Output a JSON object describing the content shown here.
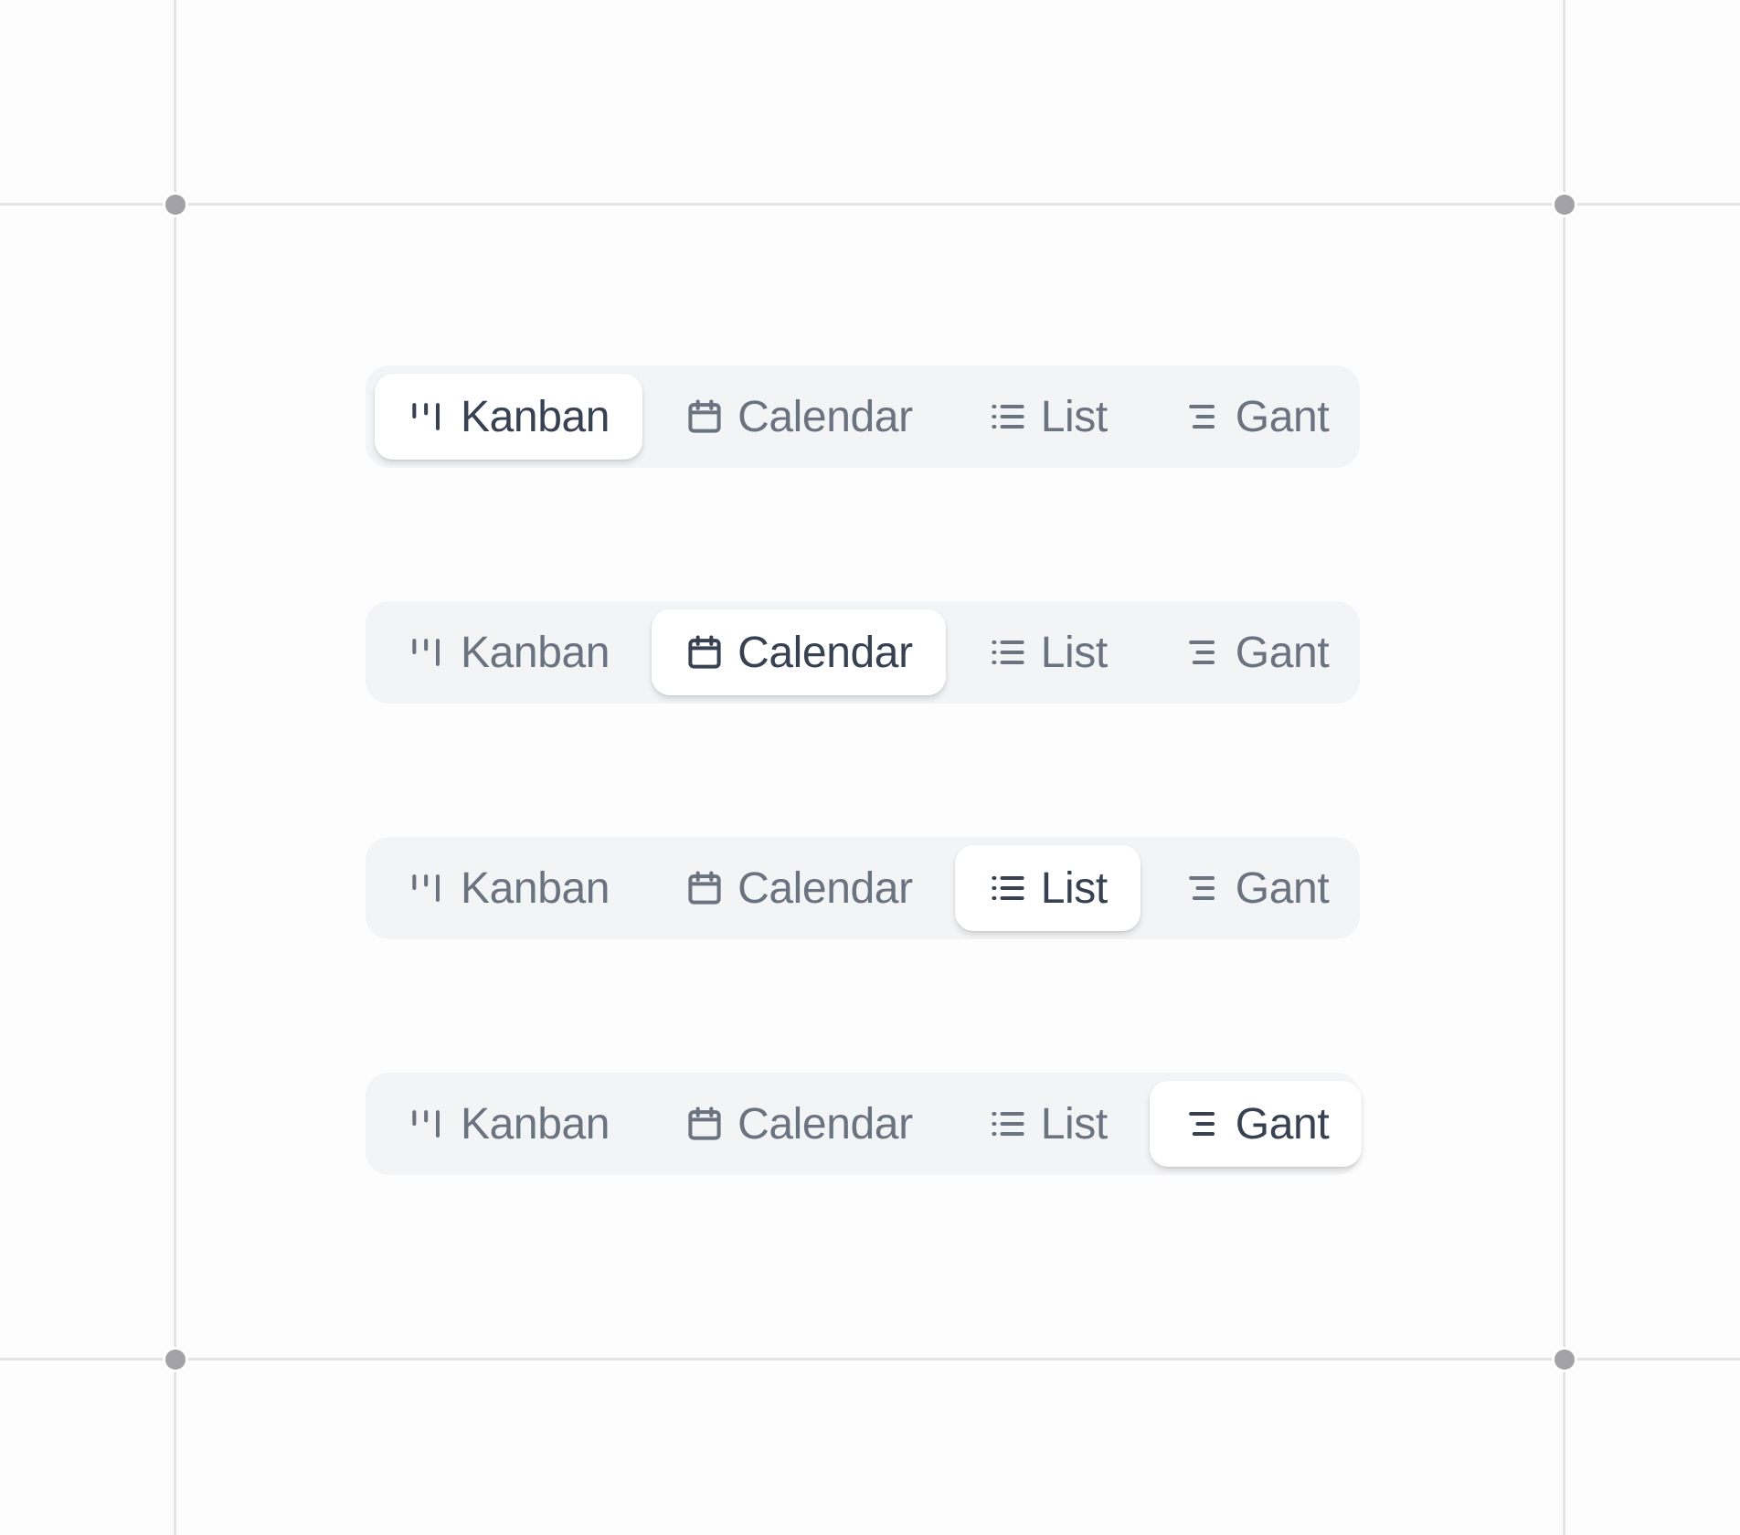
{
  "tabs": [
    {
      "key": "kanban",
      "label": "Kanban",
      "icon": "kanban-icon"
    },
    {
      "key": "calendar",
      "label": "Calendar",
      "icon": "calendar-icon"
    },
    {
      "key": "list",
      "label": "List",
      "icon": "list-icon"
    },
    {
      "key": "gant",
      "label": "Gant",
      "icon": "gantt-icon"
    }
  ],
  "rows": [
    {
      "selected": "kanban"
    },
    {
      "selected": "calendar"
    },
    {
      "selected": "list"
    },
    {
      "selected": "gant"
    }
  ],
  "colors": {
    "canvas": "#fdfdfd",
    "guide": "#e4e4e7",
    "handle": "#a1a1aa",
    "control_bg": "#f3f4f6",
    "active_bg": "#ffffff",
    "active_text": "#374151",
    "inactive_text": "#6b7280"
  }
}
